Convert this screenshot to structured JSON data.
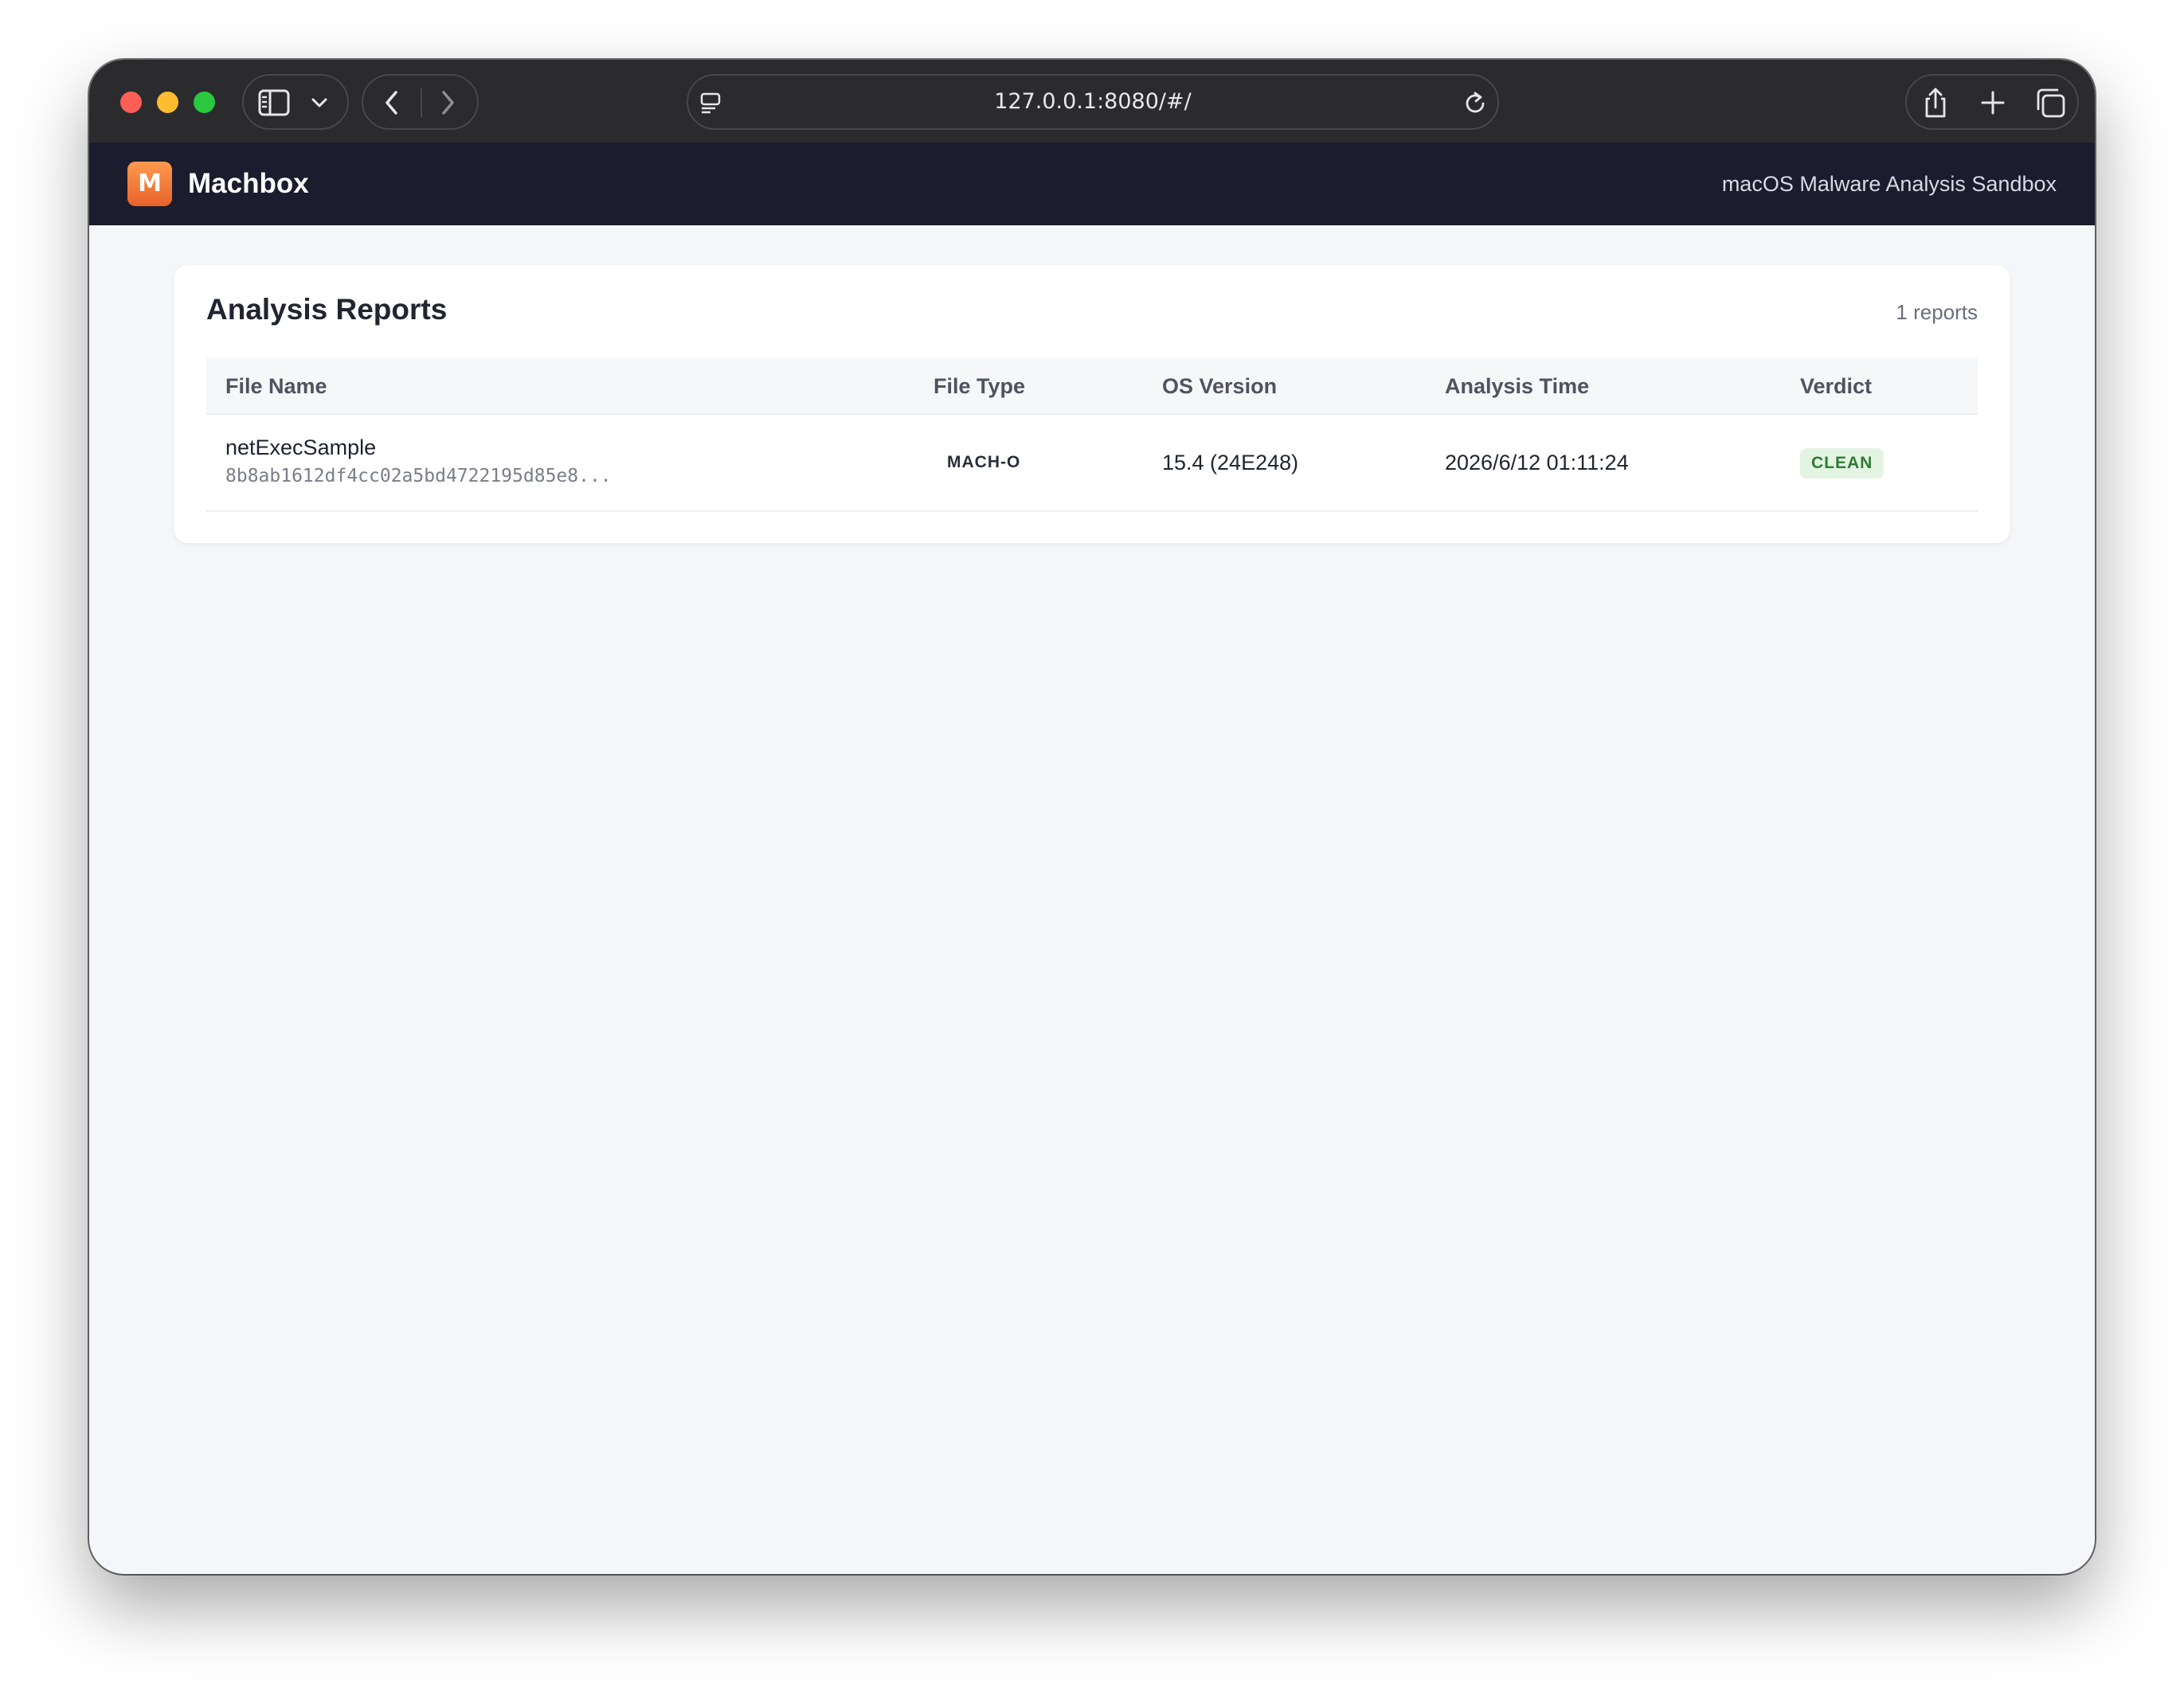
{
  "browser": {
    "url": "127.0.0.1:8080/#/"
  },
  "app": {
    "logo_letter": "M",
    "brand_name": "Machbox",
    "subtitle": "macOS Malware Analysis Sandbox"
  },
  "reports": {
    "title": "Analysis Reports",
    "count_label": "1 reports",
    "columns": {
      "file_name": "File Name",
      "file_type": "File Type",
      "os_version": "OS Version",
      "analysis_time": "Analysis Time",
      "verdict": "Verdict"
    },
    "rows": [
      {
        "file_name": "netExecSample",
        "hash": "8b8ab1612df4cc02a5bd4722195d85e8...",
        "file_type": "MACH-O",
        "os_version": "15.4 (24E248)",
        "analysis_time": "2026/6/12 01:11:24",
        "verdict": "CLEAN"
      }
    ]
  },
  "icons": {
    "traffic_lights": [
      "close-icon",
      "minimize-icon",
      "zoom-icon"
    ],
    "toolbar": [
      "sidebar-icon",
      "chevron-down-icon",
      "back-icon",
      "forward-icon",
      "page-settings-icon",
      "reload-icon",
      "share-icon",
      "new-tab-icon",
      "tab-overview-icon"
    ]
  },
  "colors": {
    "header_bg": "#1b1c2e",
    "logo_accent": "#e8622a",
    "verdict_clean_bg": "#e3f4e3",
    "verdict_clean_text": "#2e7d32",
    "page_bg": "#f5f6fa"
  }
}
